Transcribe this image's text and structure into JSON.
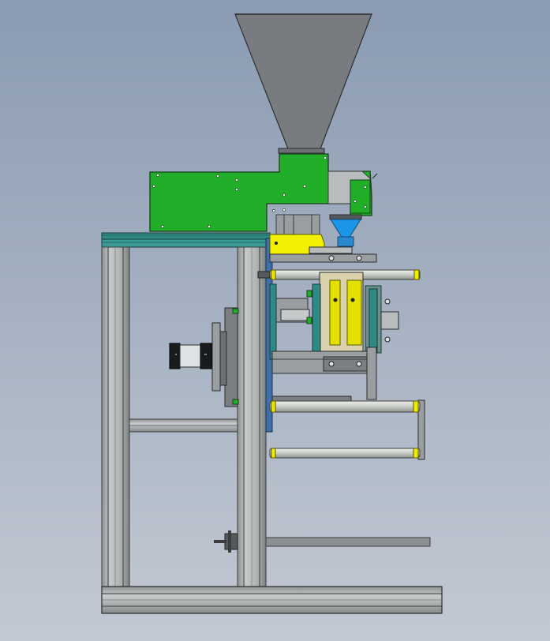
{
  "scene": {
    "background_top": "#8a9bb2",
    "background_bottom": "#c3c9d3",
    "colors": {
      "hopper": "#787b80",
      "mount_plate": "#21ae29",
      "frame": "#b0b3b4",
      "frame_dark": "#3c3d3f",
      "teal_rail": "#2f8a86",
      "yellow_part": "#f2f000",
      "blue_cone": "#1a96e6",
      "roller": "#d2d6d0",
      "roller_cap": "#f0ec00",
      "motor_gray": "#9a9ea1",
      "dark_steel": "#55595c"
    },
    "components": [
      "hopper",
      "green-mount-plate",
      "dosing-cone",
      "vertical-frame",
      "film-rollers",
      "pneumatic-cylinder",
      "sealing-jaws",
      "base-frame",
      "lower-shaft"
    ]
  }
}
